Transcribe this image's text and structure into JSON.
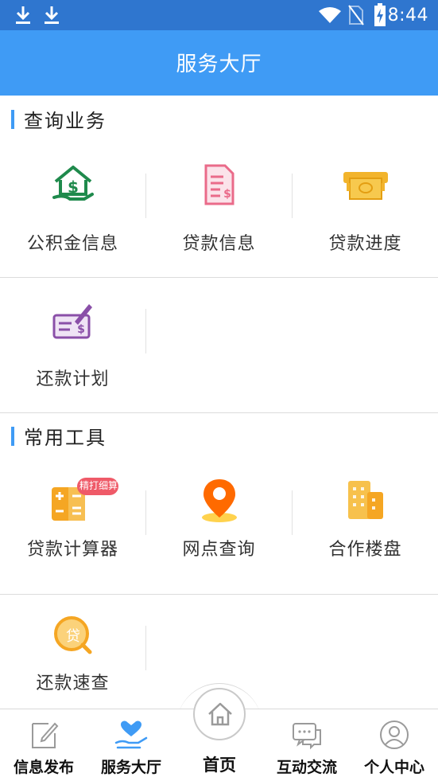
{
  "status_bar": {
    "time": "8:44",
    "icons": [
      "download-icon",
      "download-icon",
      "wifi-icon",
      "no-sim-icon",
      "battery-charging-icon"
    ]
  },
  "header": {
    "title": "服务大厅"
  },
  "sections": {
    "query": {
      "title": "查询业务",
      "items": [
        {
          "label": "公积金信息",
          "icon": "house-money-icon"
        },
        {
          "label": "贷款信息",
          "icon": "loan-document-icon"
        },
        {
          "label": "贷款进度",
          "icon": "cash-machine-icon"
        },
        {
          "label": "还款计划",
          "icon": "check-sign-icon"
        }
      ]
    },
    "tools": {
      "title": "常用工具",
      "items": [
        {
          "label": "贷款计算器",
          "icon": "calculator-icon",
          "badge": "精打细算"
        },
        {
          "label": "网点查询",
          "icon": "location-pin-icon"
        },
        {
          "label": "合作楼盘",
          "icon": "building-icon"
        },
        {
          "label": "还款速查",
          "icon": "loan-search-icon",
          "glyph": "贷"
        }
      ]
    }
  },
  "tabbar": {
    "tabs": [
      {
        "label": "信息发布",
        "icon": "edit-note-icon"
      },
      {
        "label": "服务大厅",
        "icon": "heart-hand-icon",
        "active": true
      },
      {
        "label": "首页",
        "icon": "home-icon"
      },
      {
        "label": "互动交流",
        "icon": "chat-icon"
      },
      {
        "label": "个人中心",
        "icon": "user-icon"
      }
    ]
  },
  "colors": {
    "status_bar": "#2f76cf",
    "header": "#3f9bf5",
    "accent": "#3f9bf5",
    "green": "#1f8a4c",
    "pink": "#ea6b8a",
    "gold": "#f2b42c",
    "purple": "#8a4fa8",
    "orange": "#f5a623",
    "pin_orange": "#ff6a00"
  }
}
